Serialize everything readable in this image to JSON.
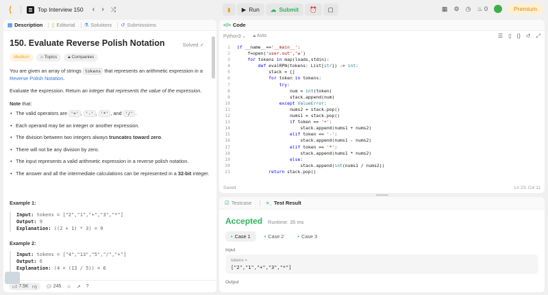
{
  "topbar": {
    "problem_list": "Top Interview 150",
    "run": "Run",
    "submit": "Submit",
    "streak": "0",
    "premium": "Premium"
  },
  "left_tabs": [
    "Description",
    "Editorial",
    "Solutions",
    "Submissions"
  ],
  "problem": {
    "title": "150. Evaluate Reverse Polish Notation",
    "status": "Solved",
    "difficulty": "Medium",
    "topics": "Topics",
    "companies": "Companies",
    "intro_a": "You are given an array of strings ",
    "intro_code": "tokens",
    "intro_b": " that represents an arithmetic expression in a ",
    "intro_link": "Reverse Polish Notation",
    "intro_c": ".",
    "evaluate_a": "Evaluate the expression. Return ",
    "evaluate_em": "an integer that represents the value of the expression",
    "evaluate_b": ".",
    "note": "Note",
    "note_rest": " that:",
    "b1_a": "The valid operators are ",
    "ops": [
      "'+'",
      "'-'",
      "'*'",
      "'/'"
    ],
    "b1_sep1": ", ",
    "b1_and": ", and ",
    "b1_end": ".",
    "b2": "Each operand may be an integer or another expression.",
    "b3_a": "The division between two integers always ",
    "b3_b": "truncates toward zero",
    "b3_c": ".",
    "b4": "There will not be any division by zero.",
    "b5": "The input represents a valid arithmetic expression in a reverse polish notation.",
    "b6_a": "The answer and all the intermediate calculations can be represented in a ",
    "b6_b": "32-bit",
    "b6_c": " integer."
  },
  "examples": [
    {
      "title": "Example 1:",
      "input_label": "Input:",
      "input": "tokens = [\"2\",\"1\",\"+\",\"3\",\"*\"]",
      "output_label": "Output:",
      "output": "9",
      "expl_label": "Explanation:",
      "expl": "((2 + 1) * 3) = 9"
    },
    {
      "title": "Example 2:",
      "input_label": "Input:",
      "input": "tokens = [\"4\",\"13\",\"5\",\"/\",\"+\"]",
      "output_label": "Output:",
      "output": "6",
      "expl_label": "Explanation:",
      "expl": "(4 + (13 / 5)) = 6"
    }
  ],
  "footer": {
    "likes": "7.5K",
    "comments": "245"
  },
  "code_panel": {
    "tab": "Code",
    "language": "Python3",
    "mode": "Auto",
    "saved": "Saved",
    "cursor": "Ln 23, Col 11"
  },
  "code_lines": [
    "<span class='kw'>if</span> __name__==<span class='st'>'__main__'</span>:",
    "    f=open(<span class='st'>'user.out'</span>,<span class='st'>'w'</span>)",
    "    <span class='kw'>for</span> tokens <span class='kw'>in</span> map(loads,stdin):",
    "        <span class='kw'>def</span> evalRPN(tokens: List[<span class='bi'>str</span>]) -> <span class='bi'>int</span>:",
    "            stack = []",
    "            <span class='kw'>for</span> token <span class='kw'>in</span> tokens:",
    "                <span class='kw'>try</span>:",
    "                    num = <span class='bi'>int</span>(token)",
    "                    stack.append(num)",
    "                <span class='kw'>except</span> <span class='bi'>ValueError</span>:",
    "                    nums2 = stack.pop()",
    "                    nums1 = stack.pop()",
    "                    <span class='kw'>if</span> token == <span class='st'>'+'</span>:",
    "                        stack.append(nums1 + nums2)",
    "                    <span class='kw'>elif</span> token == <span class='st'>'-'</span>:",
    "                        stack.append(nums1 - nums2)",
    "                    <span class='kw'>elif</span> token == <span class='st'>'*'</span>:",
    "                        stack.append(nums1 * nums2)",
    "                    <span class='kw'>else</span>:",
    "                        stack.append(<span class='bi'>int</span>(nums1 / nums2))",
    "            <span class='kw'>return</span> stack.pop()"
  ],
  "result_panel": {
    "tab_testcase": "Testcase",
    "tab_result": "Test Result",
    "verdict": "Accepted",
    "runtime": "Runtime: 35 ms",
    "cases": [
      "Case 1",
      "Case 2",
      "Case 3"
    ],
    "input_label": "Input",
    "var_name": "tokens =",
    "var_value": "[\"2\",\"1\",\"+\",\"3\",\"*\"]",
    "output_label": "Output"
  }
}
